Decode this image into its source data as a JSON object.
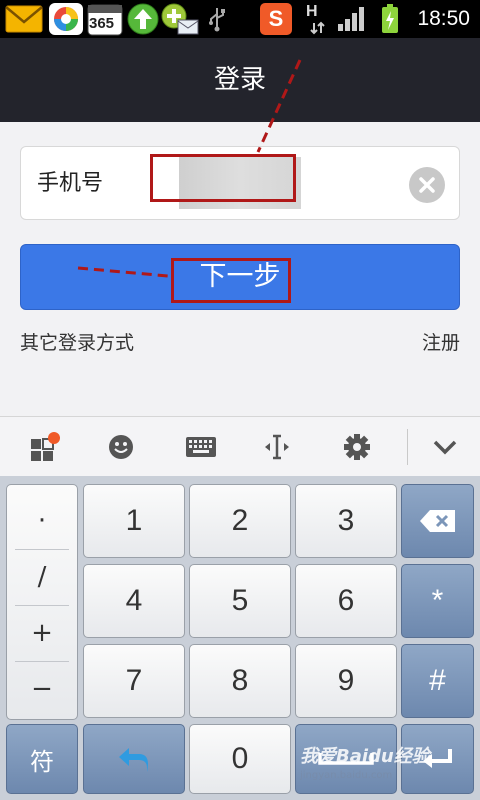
{
  "statusbar": {
    "time": "18:50",
    "icons": [
      "mail-icon",
      "app-market-icon",
      "calendar-365-icon",
      "upload-arrow-icon",
      "plus-mail-icon",
      "usb-icon",
      "sogou-s-icon",
      "hsdpa-icon",
      "signal-icon",
      "battery-icon"
    ],
    "calendar_text": "365",
    "network_text": "H",
    "sogou_text": "S"
  },
  "header": {
    "title": "登录"
  },
  "form": {
    "phone_label": "手机号",
    "next_button": "下一步",
    "other_login": "其它登录方式",
    "register": "注册"
  },
  "toolbar": {
    "icons": [
      "apps-grid-icon",
      "emoji-icon",
      "keyboard-icon",
      "cursor-icon",
      "settings-icon",
      "collapse-chevron-icon"
    ],
    "notification_color": "#f05a28"
  },
  "keyboard": {
    "symbols": [
      "·",
      "/",
      "+",
      "−"
    ],
    "keys": [
      "1",
      "2",
      "3",
      "4",
      "5",
      "6",
      "7",
      "8",
      "9",
      "0"
    ],
    "star": "*",
    "hash": "#",
    "fu": "符"
  },
  "watermark": {
    "text": "我爱Baidu经验",
    "url": "jingyan.baidu.com"
  },
  "colors": {
    "accent": "#3b78e7",
    "annotation": "#b01818",
    "titlebar": "#23242c"
  }
}
